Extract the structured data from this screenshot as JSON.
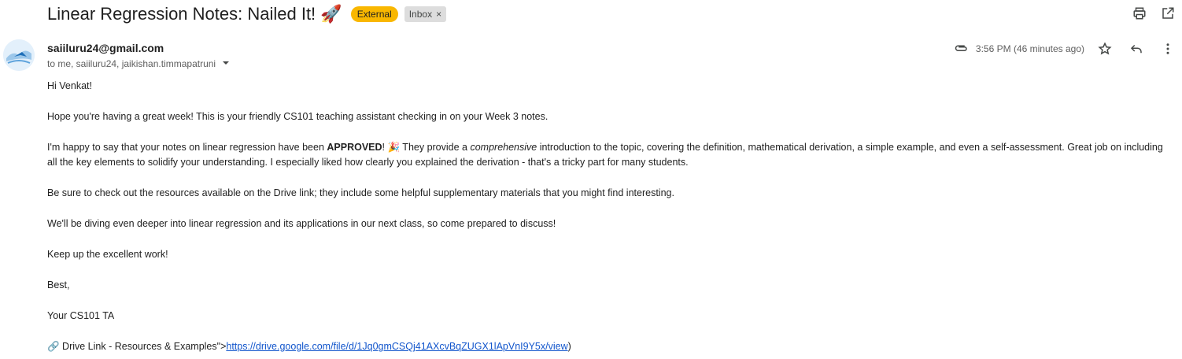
{
  "email": {
    "subject": "Linear Regression Notes: Nailed It! 🚀",
    "labels": {
      "external": "External",
      "inbox": "Inbox",
      "remove_symbol": "×"
    },
    "sender_email": "saiiluru24@gmail.com",
    "recipients": "to me, saiiluru24, jaikishan.timmapatruni",
    "time": "3:56 PM (46 minutes ago)",
    "body": {
      "greeting": "Hi Venkat!",
      "p1": "Hope you're having a great week! This is your friendly CS101 teaching assistant checking in on your Week 3 notes.",
      "p2_part1": "I'm happy to say that your notes on linear regression have been ",
      "p2_bold": "APPROVED",
      "p2_part2": "! 🎉 They provide a ",
      "p2_italic": "comprehensive",
      "p2_part3": " introduction to the topic, covering the definition, mathematical derivation, a simple example, and even a self-assessment. Great job on including all the key elements to solidify your understanding. I especially liked how clearly you explained the derivation - that's a tricky part for many students.",
      "p3": "Be sure to check out the resources available on the Drive link; they include some helpful supplementary materials that you might find interesting.",
      "p4": "We'll be diving even deeper into linear regression and its applications in our next class, so come prepared to discuss!",
      "p5": "Keep up the excellent work!",
      "closing": "Best,",
      "signature": "Your CS101 TA",
      "link_prefix": "🔗 Drive Link - Resources & Examples\">",
      "link_url": "https://drive.google.com/file/d/1Jq0gmCSQj41AXcvBqZUGX1lApVnI9Y5x/view",
      "link_suffix": ")"
    }
  },
  "icons": {
    "print": "print-icon",
    "open_new_window": "open-in-new-window-icon",
    "attachment": "paperclip-icon",
    "star": "star-icon",
    "reply": "reply-icon",
    "more": "more-vertical-icon",
    "expand_recipients": "chevron-down-icon"
  },
  "colors": {
    "external_chip": "#f9b700",
    "inbox_chip": "#dddddd",
    "link": "#1155cc"
  }
}
